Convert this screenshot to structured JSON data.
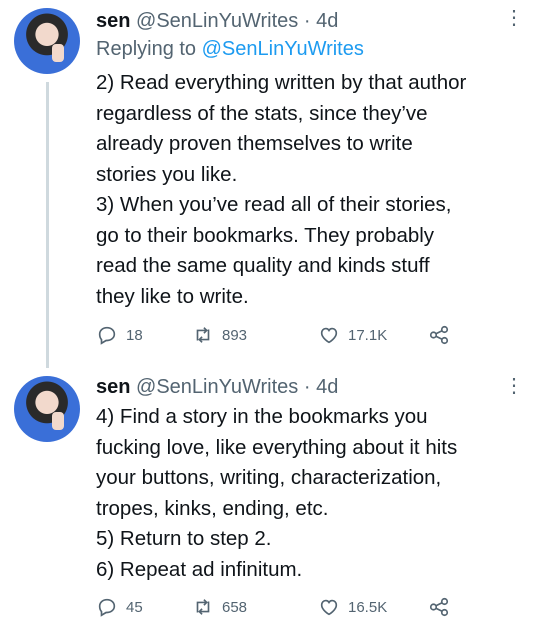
{
  "tweets": [
    {
      "name": "sen",
      "handle": "@SenLinYuWrites",
      "dot": "·",
      "time": "4d",
      "replying_prefix": "Replying to",
      "replying_to": "@SenLinYuWrites",
      "lines": [
        "2) Read everything written by that author",
        "regardless of the stats, since they’ve",
        "already proven themselves to write",
        "stories you like.",
        "3) When you’ve read all of their stories,",
        "go to their bookmarks. They probably",
        "read the same quality and kinds stuff",
        "they like to write."
      ],
      "replies": "18",
      "retweets": "893",
      "likes": "17.1K"
    },
    {
      "name": "sen",
      "handle": "@SenLinYuWrites",
      "dot": "·",
      "time": "4d",
      "lines": [
        "4) Find a story in the bookmarks you",
        "fucking love, like everything about it hits",
        "your buttons, writing, characterization,",
        "tropes, kinks, ending, etc.",
        "5) Return to step 2.",
        "6) Repeat ad infinitum."
      ],
      "replies": "45",
      "retweets": "658",
      "likes": "16.5K"
    }
  ],
  "icons": {
    "reply": "reply-icon",
    "retweet": "retweet-icon",
    "like": "heart-icon",
    "share": "share-icon",
    "more": "more-icon"
  },
  "colors": {
    "text": "#0f1419",
    "secondary": "#536471",
    "link": "#1d9bf0",
    "thread_line": "#cfd9de"
  }
}
